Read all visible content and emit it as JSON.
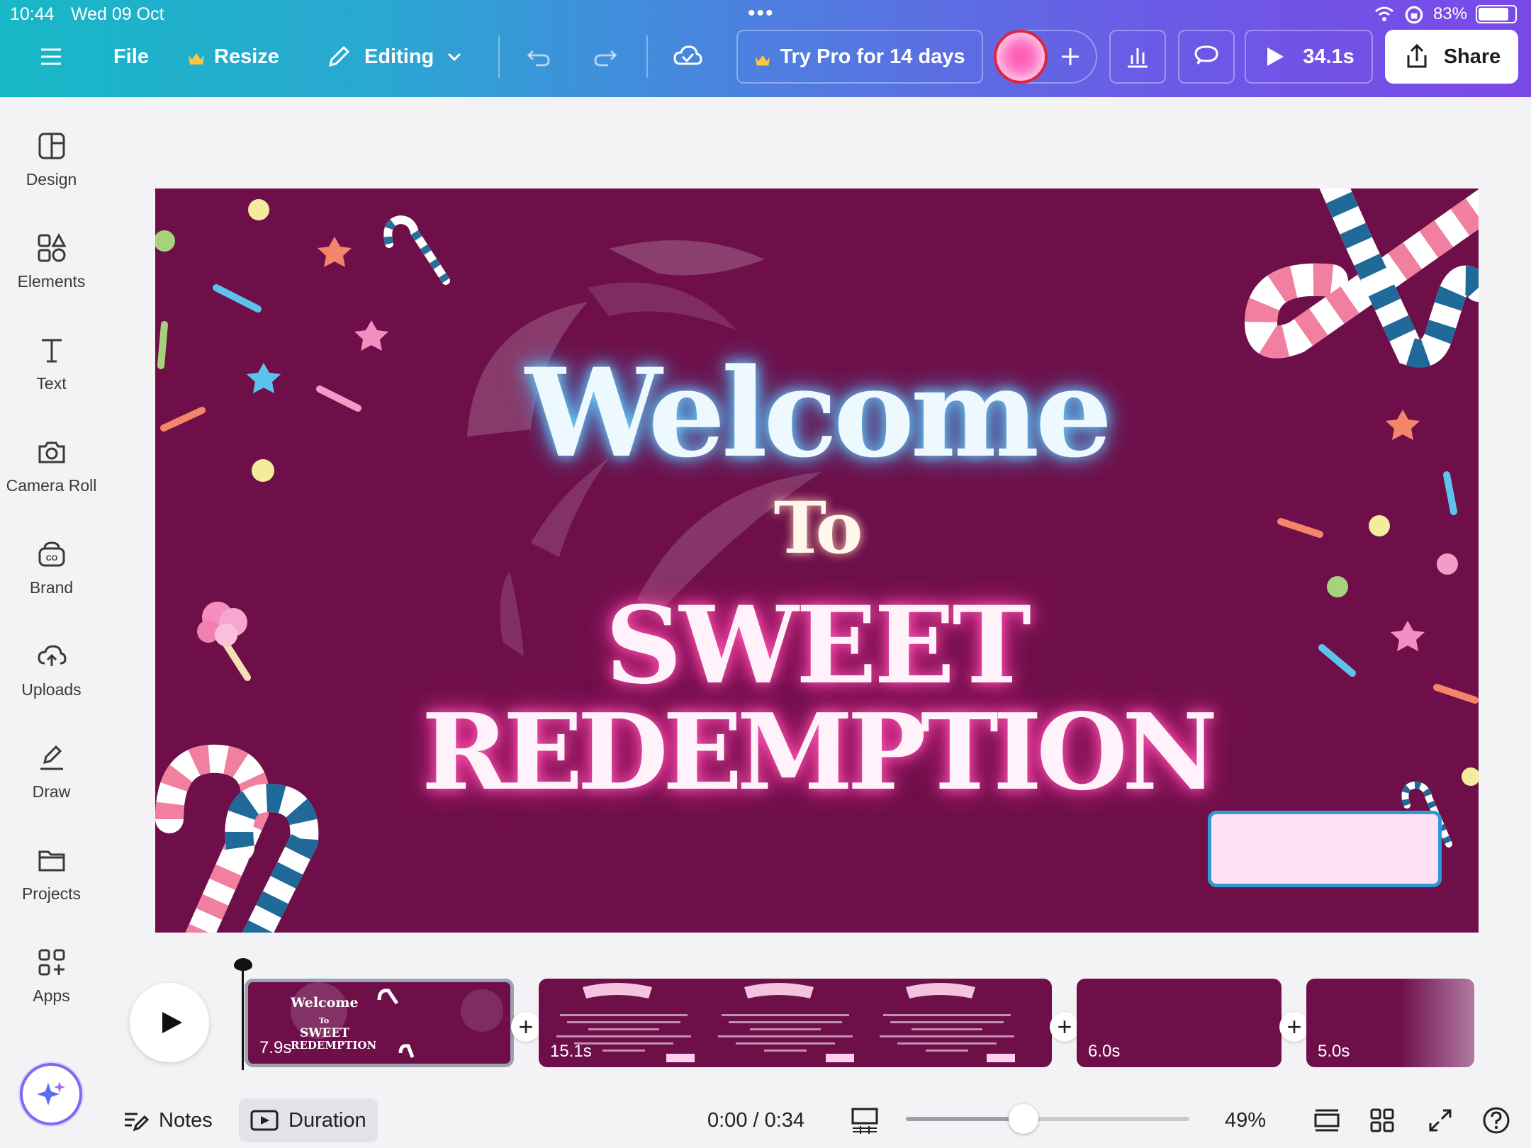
{
  "status": {
    "time": "10:44",
    "date": "Wed 09 Oct",
    "battery": "83%"
  },
  "toolbar": {
    "file": "File",
    "resize": "Resize",
    "editing": "Editing",
    "try_pro": "Try Pro for 14 days",
    "play_time": "34.1s",
    "share": "Share"
  },
  "sidebar": {
    "items": [
      {
        "label": "Design",
        "icon": "design-icon"
      },
      {
        "label": "Elements",
        "icon": "elements-icon"
      },
      {
        "label": "Text",
        "icon": "text-icon"
      },
      {
        "label": "Camera Roll",
        "icon": "camera-icon"
      },
      {
        "label": "Brand",
        "icon": "brand-icon"
      },
      {
        "label": "Uploads",
        "icon": "upload-cloud-icon"
      },
      {
        "label": "Draw",
        "icon": "draw-icon"
      },
      {
        "label": "Projects",
        "icon": "folder-icon"
      },
      {
        "label": "Apps",
        "icon": "apps-icon"
      }
    ]
  },
  "canvas": {
    "line1": "Welcome",
    "line2": "To",
    "line3": "SWEET",
    "line4": "REDEMPTION",
    "background": "#6e0f4a"
  },
  "timeline": {
    "clips": [
      {
        "duration": "7.9s",
        "thumb_title": "Welcome",
        "thumb_to": "To",
        "thumb_sweet": "SWEET",
        "thumb_redemption": "REDEMPTION"
      },
      {
        "duration": "15.1s"
      },
      {
        "duration": "6.0s"
      },
      {
        "duration": "5.0s"
      }
    ]
  },
  "bottom": {
    "notes": "Notes",
    "duration": "Duration",
    "time": "0:00 / 0:34",
    "zoom": "49%",
    "zoom_fraction": 0.49
  }
}
